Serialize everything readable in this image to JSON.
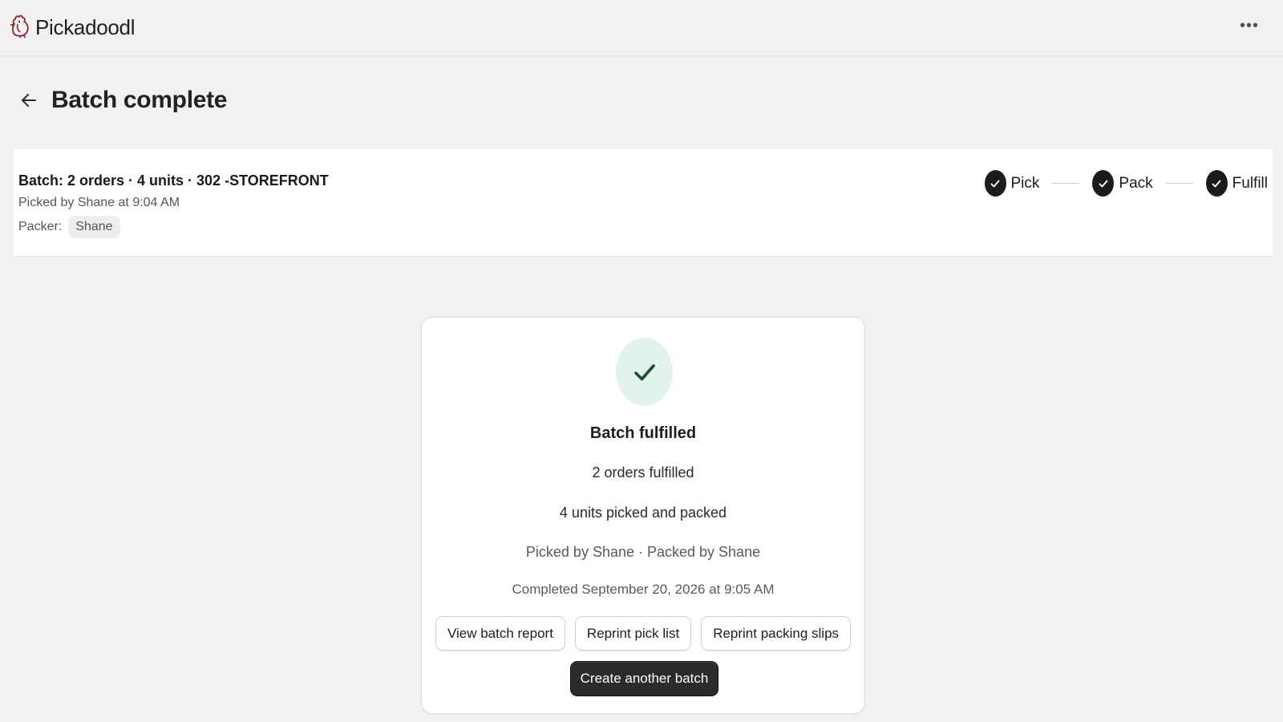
{
  "app": {
    "name": "Pickadoodl",
    "more_label": "•••"
  },
  "header": {
    "title": "Batch complete"
  },
  "batch": {
    "summary": "Batch: 2 orders · 4 units · 302 -STOREFRONT",
    "picked_by": "Picked by Shane at 9:04 AM",
    "packer_label": "Packer:",
    "packer_name": "Shane"
  },
  "steps": [
    {
      "label": "Pick",
      "done": true
    },
    {
      "label": "Pack",
      "done": true
    },
    {
      "label": "Fulfill",
      "done": true
    }
  ],
  "card": {
    "title": "Batch fulfilled",
    "orders": "2 orders fulfilled",
    "units": "4 units picked and packed",
    "people": "Picked by Shane · Packed by Shane",
    "completed": "Completed September 20, 2026 at 9:05 AM",
    "buttons": {
      "view_report": "View batch report",
      "reprint_pick": "Reprint pick list",
      "reprint_slips": "Reprint packing slips",
      "create_batch": "Create another batch"
    }
  },
  "colors": {
    "success_bg": "#dff3ea",
    "success_check": "#1e4d36",
    "primary_button": "#2b2b2b",
    "brand_logo": "#8a2a22"
  },
  "icons": {
    "logo": "rooster-logo-icon",
    "more": "more-horizontal-icon",
    "back": "arrow-left-icon",
    "step": "check-circle-icon",
    "success": "check-icon"
  }
}
